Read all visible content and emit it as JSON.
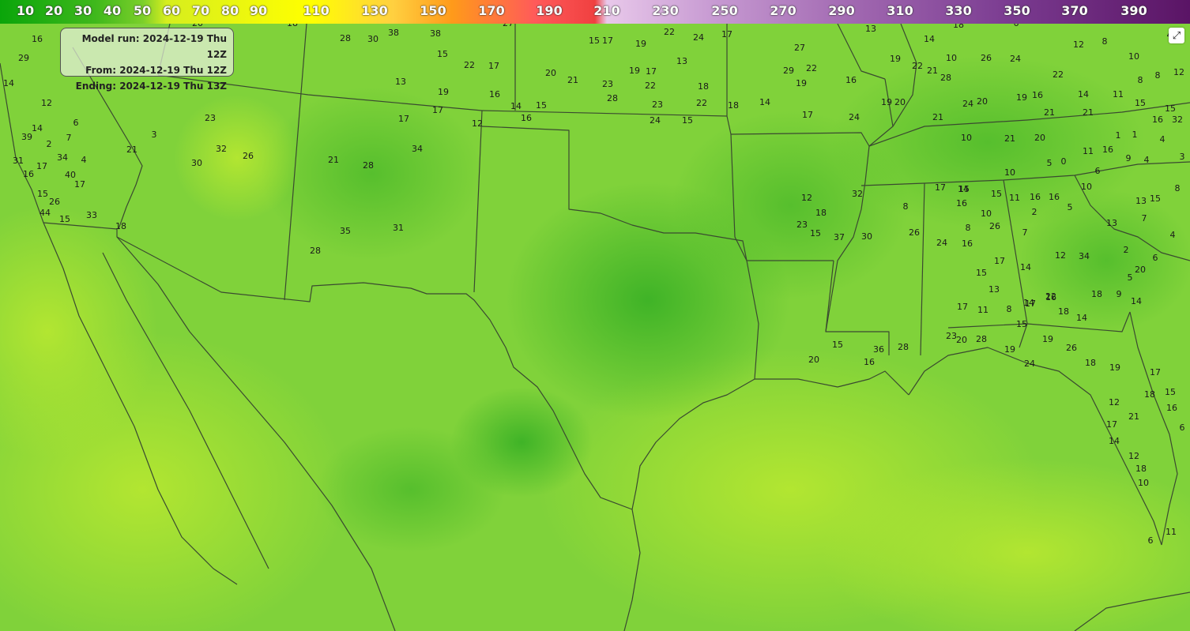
{
  "color_scale": {
    "ticks": [
      "10",
      "20",
      "30",
      "40",
      "50",
      "60",
      "70",
      "80",
      "90",
      "110",
      "130",
      "150",
      "170",
      "190",
      "210",
      "230",
      "250",
      "270",
      "290",
      "310",
      "330",
      "350",
      "370",
      "390"
    ]
  },
  "info_box": {
    "model_run": "Model run: 2024-12-19 Thu 12Z",
    "from": "From: 2024-12-19 Thu 12Z",
    "ending": "Ending: 2024-12-19 Thu 13Z"
  },
  "station_values": [
    "18",
    "20",
    "28",
    "30",
    "38",
    "38",
    "27",
    "15",
    "17",
    "19",
    "22",
    "24",
    "17",
    "13",
    "14",
    "18",
    "6",
    "8",
    "12",
    "4",
    "16",
    "14",
    "12",
    "6",
    "14",
    "39",
    "2",
    "7",
    "31",
    "17",
    "34",
    "4",
    "40",
    "17",
    "16",
    "15",
    "26",
    "44",
    "15",
    "33",
    "18",
    "21",
    "3",
    "23",
    "32",
    "30",
    "26",
    "21",
    "28",
    "34",
    "35",
    "29",
    "31",
    "28",
    "22",
    "15",
    "17",
    "13",
    "19",
    "17",
    "16",
    "17",
    "12",
    "14",
    "15",
    "16",
    "20",
    "21",
    "23",
    "28",
    "19",
    "17",
    "22",
    "23",
    "24",
    "15",
    "18",
    "22",
    "13",
    "18",
    "14",
    "27",
    "29",
    "22",
    "19",
    "17",
    "24",
    "16",
    "19",
    "20",
    "19",
    "22",
    "21",
    "28",
    "10",
    "26",
    "24",
    "22",
    "24",
    "20",
    "19",
    "16",
    "14",
    "11",
    "15",
    "10",
    "8",
    "8",
    "15",
    "12",
    "21",
    "21",
    "16",
    "32",
    "21",
    "10",
    "21",
    "20",
    "11",
    "16",
    "9",
    "4",
    "3",
    "1",
    "1",
    "4",
    "5",
    "0",
    "6",
    "10",
    "17",
    "14",
    "15",
    "11",
    "16",
    "16",
    "5",
    "10",
    "13",
    "15",
    "8",
    "7",
    "13",
    "4",
    "6",
    "20",
    "2",
    "5",
    "14",
    "9",
    "19",
    "12",
    "17",
    "21",
    "17",
    "15",
    "18",
    "16",
    "6",
    "14",
    "12",
    "18",
    "10",
    "6",
    "11",
    "18",
    "14",
    "18",
    "22",
    "17",
    "19",
    "26",
    "18",
    "24",
    "19",
    "28",
    "20",
    "23",
    "28",
    "36",
    "16",
    "15",
    "20",
    "23",
    "12",
    "18",
    "15",
    "37",
    "30",
    "32",
    "8",
    "26",
    "24",
    "16",
    "8",
    "26",
    "10",
    "16",
    "15",
    "17",
    "14",
    "12",
    "34",
    "7",
    "2",
    "15",
    "13",
    "17",
    "11",
    "8",
    "15",
    "14",
    "16",
    "17",
    "19",
    "15",
    "13",
    "12",
    "27",
    "24",
    "14",
    "20",
    "11",
    "14",
    "4"
  ]
}
